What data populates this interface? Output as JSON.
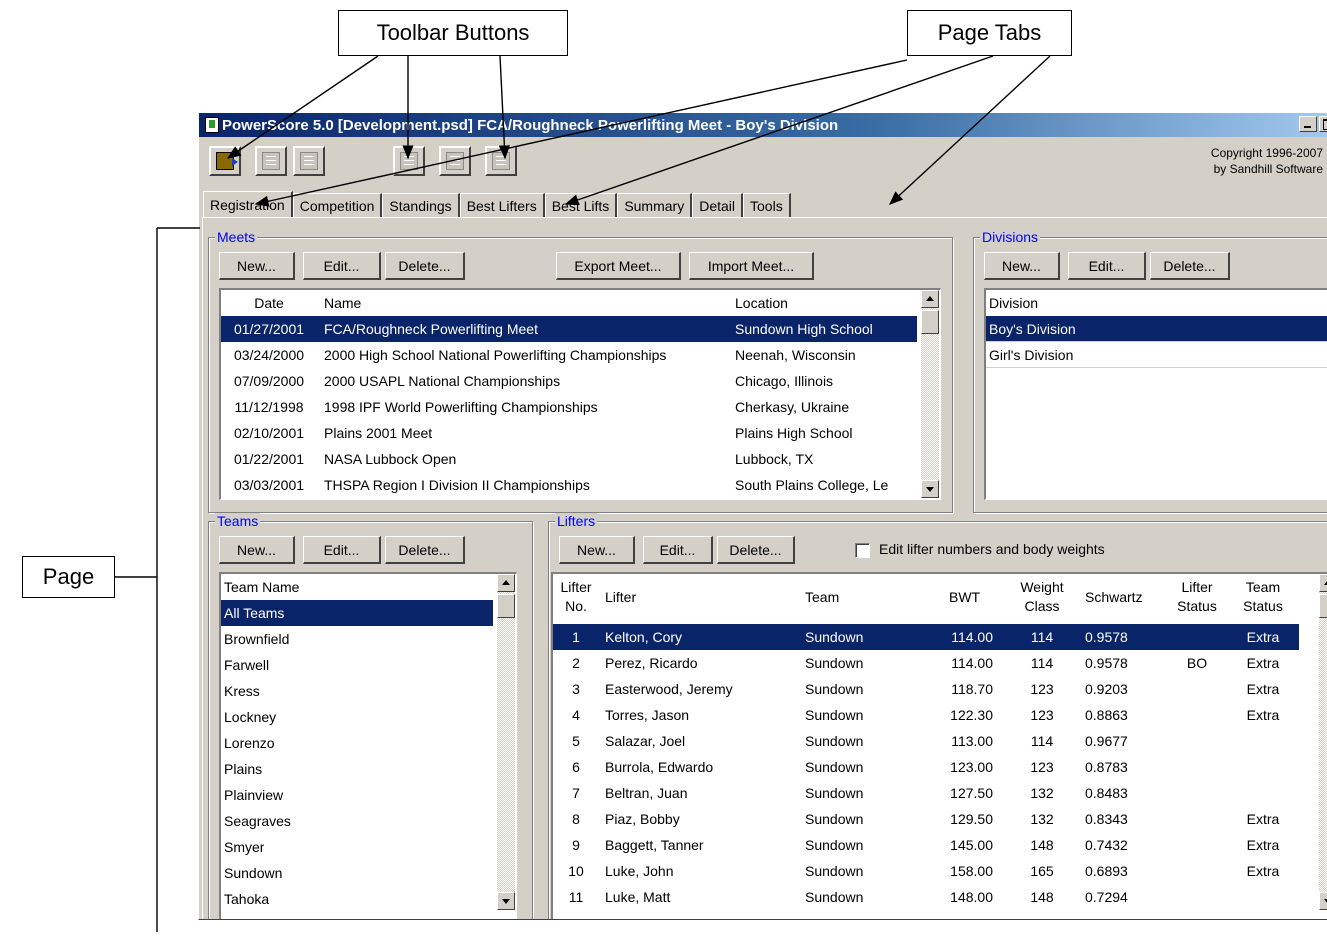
{
  "callouts": {
    "toolbar_buttons": "Toolbar Buttons",
    "page_tabs": "Page Tabs",
    "page": "Page"
  },
  "window": {
    "title": "PowerScore 5.0 [Development.psd] FCA/Roughneck Powerlifting Meet - Boy's Division",
    "copyright_line1": "Copyright 1996-2007",
    "copyright_line2": "by Sandhill Software"
  },
  "toolbar": {
    "buttons": [
      "exit-icon",
      "print-icon",
      "copy-icon",
      "weigh-in-icon",
      "flights-icon",
      "scoresheet-icon"
    ]
  },
  "tabs": [
    "Registration",
    "Competition",
    "Standings",
    "Best Lifters",
    "Best Lifts",
    "Summary",
    "Detail",
    "Tools"
  ],
  "meets": {
    "title": "Meets",
    "buttons": {
      "new": "New...",
      "edit": "Edit...",
      "delete": "Delete...",
      "export": "Export Meet...",
      "import": "Import Meet..."
    },
    "columns": [
      "Date",
      "Name",
      "Location"
    ],
    "rows": [
      [
        "01/27/2001",
        "FCA/Roughneck Powerlifting Meet",
        "Sundown High School"
      ],
      [
        "03/24/2000",
        "2000 High School National Powerlifting Championships",
        "Neenah, Wisconsin"
      ],
      [
        "07/09/2000",
        "2000 USAPL National Championships",
        "Chicago, Illinois"
      ],
      [
        "11/12/1998",
        "1998 IPF World Powerlifting Championships",
        "Cherkasy, Ukraine"
      ],
      [
        "02/10/2001",
        "Plains 2001 Meet",
        "Plains High School"
      ],
      [
        "01/22/2001",
        "NASA Lubbock Open",
        "Lubbock, TX"
      ],
      [
        "03/03/2001",
        "THSPA Region I Division II Championships",
        "South Plains College, Le"
      ]
    ]
  },
  "divisions": {
    "title": "Divisions",
    "buttons": {
      "new": "New...",
      "edit": "Edit...",
      "delete": "Delete..."
    },
    "column": "Division",
    "rows": [
      "Boy's Division",
      "Girl's Division"
    ]
  },
  "teams": {
    "title": "Teams",
    "buttons": {
      "new": "New...",
      "edit": "Edit...",
      "delete": "Delete..."
    },
    "column": "Team Name",
    "rows": [
      "All Teams",
      "Brownfield",
      "Farwell",
      "Kress",
      "Lockney",
      "Lorenzo",
      "Plains",
      "Plainview",
      "Seagraves",
      "Smyer",
      "Sundown",
      "Tahoka"
    ]
  },
  "lifters": {
    "title": "Lifters",
    "buttons": {
      "new": "New...",
      "edit": "Edit...",
      "delete": "Delete..."
    },
    "checkbox_label": "Edit lifter numbers and body weights",
    "columns": {
      "no_1": "Lifter",
      "no_2": "No.",
      "lifter": "Lifter",
      "team": "Team",
      "bwt": "BWT",
      "wc_1": "Weight",
      "wc_2": "Class",
      "schwartz": "Schwartz",
      "ls_1": "Lifter",
      "ls_2": "Status",
      "ts_1": "Team",
      "ts_2": "Status"
    },
    "rows": [
      [
        "1",
        "Kelton, Cory",
        "Sundown",
        "114.00",
        "114",
        "0.9578",
        "",
        "Extra"
      ],
      [
        "2",
        "Perez, Ricardo",
        "Sundown",
        "114.00",
        "114",
        "0.9578",
        "BO",
        "Extra"
      ],
      [
        "3",
        "Easterwood, Jeremy",
        "Sundown",
        "118.70",
        "123",
        "0.9203",
        "",
        "Extra"
      ],
      [
        "4",
        "Torres, Jason",
        "Sundown",
        "122.30",
        "123",
        "0.8863",
        "",
        "Extra"
      ],
      [
        "5",
        "Salazar, Joel",
        "Sundown",
        "113.00",
        "114",
        "0.9677",
        "",
        ""
      ],
      [
        "6",
        "Burrola, Edwardo",
        "Sundown",
        "123.00",
        "123",
        "0.8783",
        "",
        ""
      ],
      [
        "7",
        "Beltran, Juan",
        "Sundown",
        "127.50",
        "132",
        "0.8483",
        "",
        ""
      ],
      [
        "8",
        "Piaz, Bobby",
        "Sundown",
        "129.50",
        "132",
        "0.8343",
        "",
        "Extra"
      ],
      [
        "9",
        "Baggett, Tanner",
        "Sundown",
        "145.00",
        "148",
        "0.7432",
        "",
        "Extra"
      ],
      [
        "10",
        "Luke, John",
        "Sundown",
        "158.00",
        "165",
        "0.6893",
        "",
        "Extra"
      ],
      [
        "11",
        "Luke, Matt",
        "Sundown",
        "148.00",
        "148",
        "0.7294",
        "",
        ""
      ]
    ]
  }
}
